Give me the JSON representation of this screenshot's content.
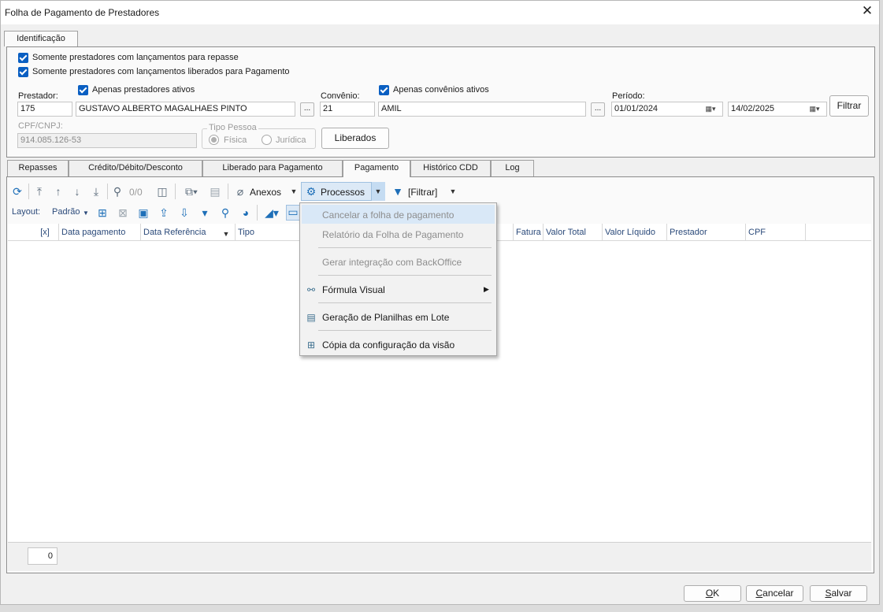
{
  "window": {
    "title": "Folha de Pagamento de Prestadores",
    "close_glyph": "✕"
  },
  "top_tab": "Identificação",
  "filters": {
    "only_repasse": "Somente prestadores com lançamentos para repasse",
    "only_liberados": "Somente prestadores com lançamentos liberados para Pagamento",
    "prestador_label": "Prestador:",
    "prestador_ativos": "Apenas prestadores ativos",
    "prestador_code": "175",
    "prestador_name": "GUSTAVO ALBERTO MAGALHAES PINTO",
    "lookup_btn": "...",
    "convenio_label": "Convênio:",
    "convenio_ativos": "Apenas convênios ativos",
    "convenio_code": "21",
    "convenio_name": "AMIL",
    "periodo_label": "Período:",
    "periodo_start": "01/01/2024",
    "periodo_end": "14/02/2025",
    "filtrar_btn": "Filtrar",
    "cpf_label": "CPF/CNPJ:",
    "cpf_value": "914.085.126-53",
    "tipo_pessoa_label": "Tipo Pessoa",
    "fisica": "Física",
    "juridica": "Jurídica",
    "liberados_btn": "Liberados"
  },
  "tabs": [
    "Repasses",
    "Crédito/Débito/Desconto",
    "Liberado para Pagamento",
    "Pagamento",
    "Histórico CDD",
    "Log"
  ],
  "toolbar": {
    "counter": "0/0",
    "anexos": "Anexos",
    "processos": "Processos",
    "filtrar": "[Filtrar]",
    "layout_label": "Layout:",
    "layout_value": "Padrão"
  },
  "grid": {
    "columns": [
      "[x]",
      "Data pagamento",
      "Data Referência",
      "Tipo",
      "Fatura",
      "Valor Total",
      "Valor Líquido",
      "Prestador",
      "CPF"
    ],
    "footer_count": "0"
  },
  "menu": {
    "items": [
      {
        "label": "Cancelar a folha de pagamento",
        "enabled": false,
        "highlighted": true
      },
      {
        "label": "Relatório da Folha de Pagamento",
        "enabled": false
      },
      {
        "label": "Gerar integração com BackOffice",
        "enabled": false
      },
      {
        "label": "Fórmula Visual",
        "enabled": true,
        "submenu": true
      },
      {
        "label": "Geração de Planilhas em Lote",
        "enabled": true
      },
      {
        "label": "Cópia da configuração da visão",
        "enabled": true
      }
    ]
  },
  "footer_buttons": {
    "ok_key": "O",
    "ok_rest": "K",
    "cancel_key": "C",
    "cancel_rest": "ancelar",
    "save_key": "S",
    "save_rest": "alvar"
  },
  "colors": {
    "accent": "#0a5fc2",
    "menu_highlight": "#d9e8f7",
    "header_text": "#2b4a7a"
  }
}
